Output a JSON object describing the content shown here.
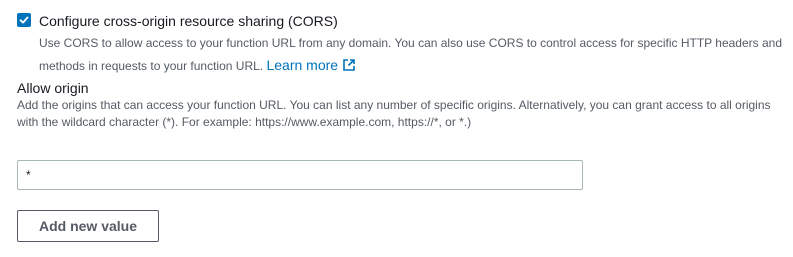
{
  "cors": {
    "checked": true,
    "label": "Configure cross-origin resource sharing (CORS)",
    "description": "Use CORS to allow access to your function URL from any domain. You can also use CORS to control access for specific HTTP headers and methods in requests to your function URL.",
    "learn_more": "Learn more",
    "learn_more_icon": "external-link-icon",
    "checkbox_color": "#0073bb"
  },
  "allow_origin": {
    "title": "Allow origin",
    "description": "Add the origins that can access your function URL. You can list any number of specific origins. Alternatively, you can grant access to all origins with the wildcard character (*). For example: https://www.example.com, https://*, or *.)",
    "value": "*",
    "add_button_label": "Add new value"
  },
  "colors": {
    "link": "#0073bb",
    "text": "#16191f",
    "secondary_text": "#545b64",
    "input_border": "#aab7b8"
  }
}
